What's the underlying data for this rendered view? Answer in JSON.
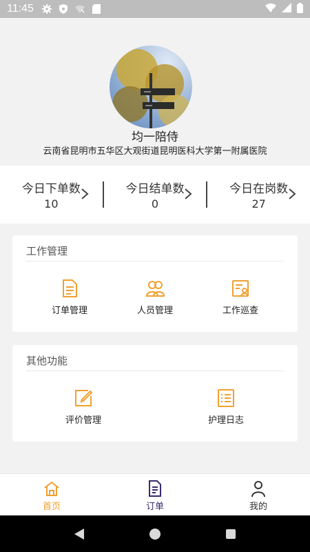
{
  "status": {
    "time": "11:45"
  },
  "profile": {
    "name": "均一陪侍",
    "address": "云南省昆明市五华区大观街道昆明医科大学第一附属医院"
  },
  "stats": [
    {
      "label": "今日下单数",
      "value": "10"
    },
    {
      "label": "今日结单数",
      "value": "0"
    },
    {
      "label": "今日在岗数",
      "value": "27"
    }
  ],
  "work": {
    "title": "工作管理",
    "items": [
      {
        "label": "订单管理",
        "icon": "document-icon"
      },
      {
        "label": "人员管理",
        "icon": "people-icon"
      },
      {
        "label": "工作巡查",
        "icon": "inspection-icon"
      }
    ]
  },
  "other": {
    "title": "其他功能",
    "items": [
      {
        "label": "评价管理",
        "icon": "edit-icon"
      },
      {
        "label": "护理日志",
        "icon": "list-icon"
      }
    ]
  },
  "nav": [
    {
      "label": "首页",
      "icon": "home-icon",
      "active": true
    },
    {
      "label": "订单",
      "icon": "order-icon",
      "active": false
    },
    {
      "label": "我的",
      "icon": "user-icon",
      "active": false
    }
  ],
  "colors": {
    "accent": "#f0a030",
    "nav_active": "#f0a030",
    "nav_order": "#3a2a6a"
  }
}
